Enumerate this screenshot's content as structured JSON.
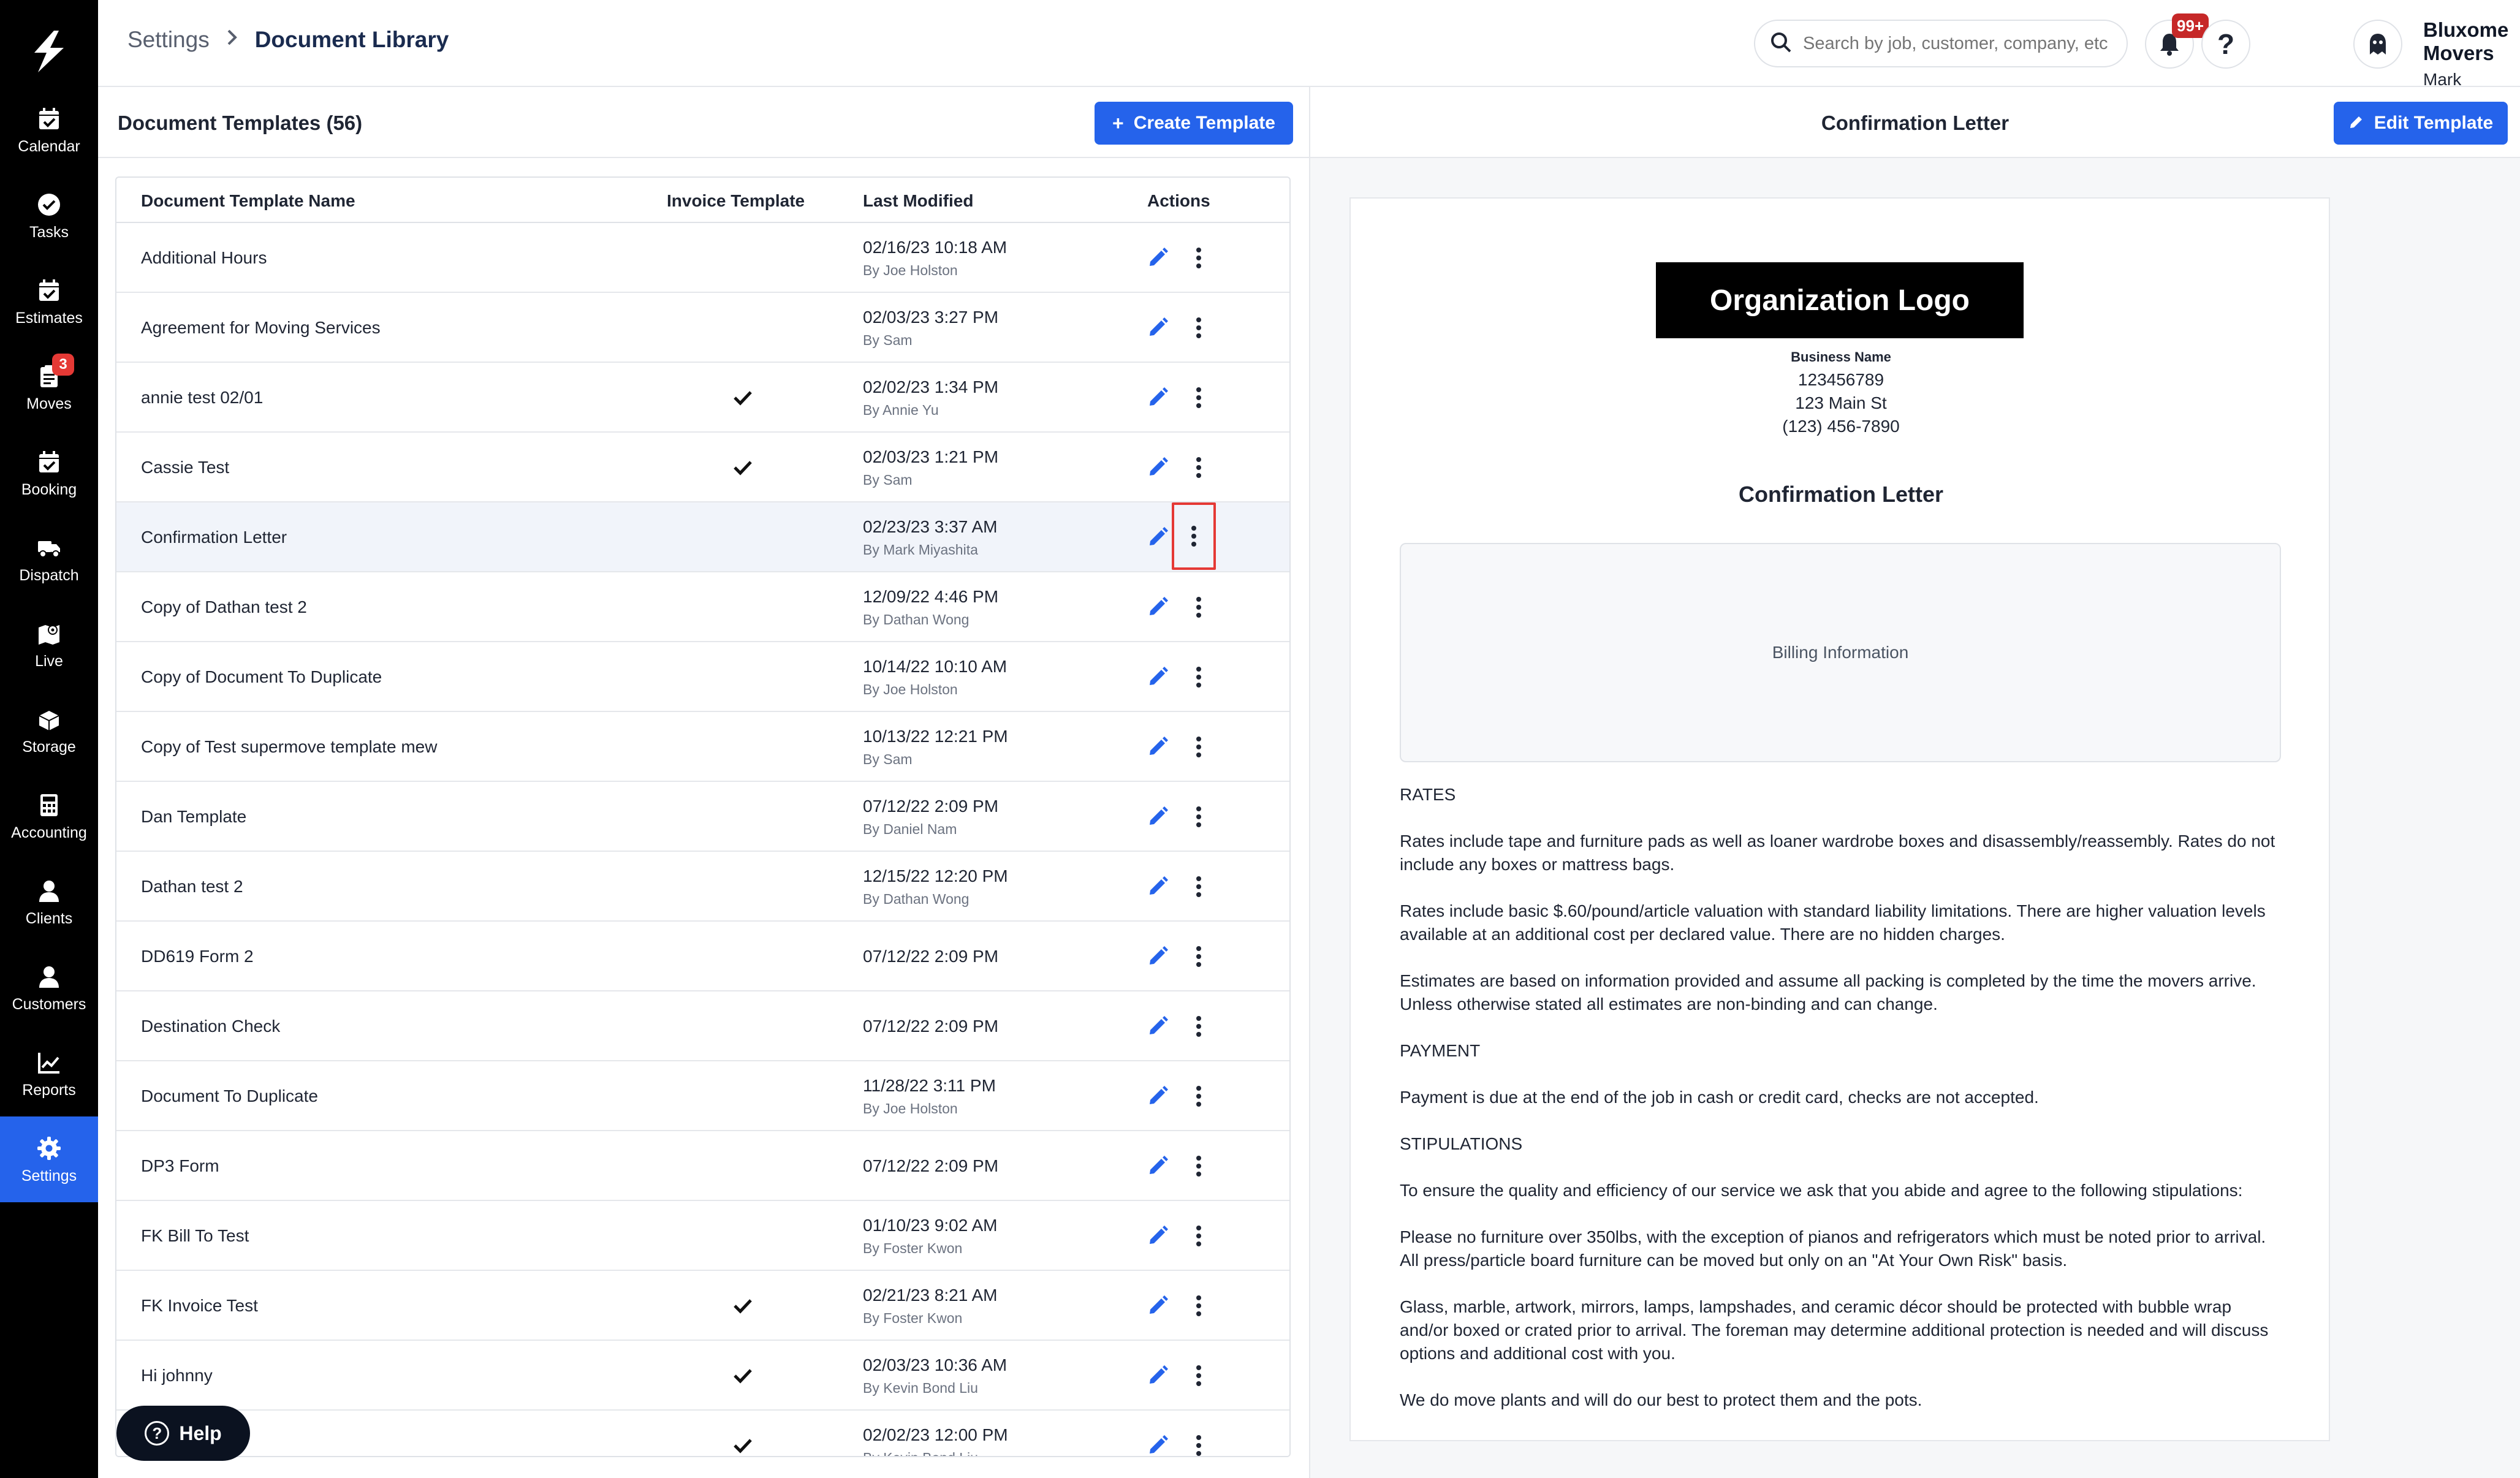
{
  "sidebar": {
    "items": [
      {
        "label": "Calendar",
        "icon": "calendar-check-icon",
        "badge": ""
      },
      {
        "label": "Tasks",
        "icon": "check-circle-icon",
        "badge": ""
      },
      {
        "label": "Estimates",
        "icon": "calendar-check-icon",
        "badge": ""
      },
      {
        "label": "Moves",
        "icon": "clipboard-icon",
        "badge": "3"
      },
      {
        "label": "Booking",
        "icon": "calendar-check-icon",
        "badge": ""
      },
      {
        "label": "Dispatch",
        "icon": "truck-icon",
        "badge": ""
      },
      {
        "label": "Live",
        "icon": "map-icon",
        "badge": ""
      },
      {
        "label": "Storage",
        "icon": "boxes-icon",
        "badge": ""
      },
      {
        "label": "Accounting",
        "icon": "calculator-icon",
        "badge": ""
      },
      {
        "label": "Clients",
        "icon": "user-icon",
        "badge": ""
      },
      {
        "label": "Customers",
        "icon": "user-icon",
        "badge": ""
      },
      {
        "label": "Reports",
        "icon": "chart-icon",
        "badge": ""
      },
      {
        "label": "Settings",
        "icon": "gear-icon",
        "badge": "",
        "active": true
      }
    ],
    "active_color": "#2563eb"
  },
  "header": {
    "breadcrumb": {
      "parent": "Settings",
      "current": "Document Library"
    },
    "search_placeholder": "Search by job, customer, company, etc...",
    "notification_badge": "99+",
    "company": "Bluxome Movers",
    "user": "Mark Miyashita"
  },
  "templates_panel": {
    "title": "Document Templates (56)",
    "create_button": "Create Template",
    "columns": {
      "name": "Document Template Name",
      "invoice": "Invoice Template",
      "modified": "Last Modified",
      "actions": "Actions"
    },
    "rows": [
      {
        "name": "Additional Hours",
        "invoice": false,
        "date": "02/16/23 10:18 AM",
        "by": "By Joe Holston"
      },
      {
        "name": "Agreement for Moving Services",
        "invoice": false,
        "date": "02/03/23 3:27 PM",
        "by": "By Sam"
      },
      {
        "name": "annie test 02/01",
        "invoice": true,
        "date": "02/02/23 1:34 PM",
        "by": "By Annie Yu"
      },
      {
        "name": "Cassie Test",
        "invoice": true,
        "date": "02/03/23 1:21 PM",
        "by": "By Sam"
      },
      {
        "name": "Confirmation Letter",
        "invoice": false,
        "date": "02/23/23 3:37 AM",
        "by": "By Mark Miyashita",
        "selected": true
      },
      {
        "name": "Copy of Dathan test 2",
        "invoice": false,
        "date": "12/09/22 4:46 PM",
        "by": "By Dathan Wong"
      },
      {
        "name": "Copy of Document To Duplicate",
        "invoice": false,
        "date": "10/14/22 10:10 AM",
        "by": "By Joe Holston"
      },
      {
        "name": "Copy of Test supermove template mew",
        "invoice": false,
        "date": "10/13/22 12:21 PM",
        "by": "By Sam"
      },
      {
        "name": "Dan Template",
        "invoice": false,
        "date": "07/12/22 2:09 PM",
        "by": "By Daniel Nam"
      },
      {
        "name": "Dathan test 2",
        "invoice": false,
        "date": "12/15/22 12:20 PM",
        "by": "By Dathan Wong"
      },
      {
        "name": "DD619 Form 2",
        "invoice": false,
        "date": "07/12/22 2:09 PM",
        "by": ""
      },
      {
        "name": "Destination Check",
        "invoice": false,
        "date": "07/12/22 2:09 PM",
        "by": ""
      },
      {
        "name": "Document To Duplicate",
        "invoice": false,
        "date": "11/28/22 3:11 PM",
        "by": "By Joe Holston"
      },
      {
        "name": "DP3 Form",
        "invoice": false,
        "date": "07/12/22 2:09 PM",
        "by": ""
      },
      {
        "name": "FK Bill To Test",
        "invoice": false,
        "date": "01/10/23 9:02 AM",
        "by": "By Foster Kwon"
      },
      {
        "name": "FK Invoice Test",
        "invoice": true,
        "date": "02/21/23 8:21 AM",
        "by": "By Foster Kwon"
      },
      {
        "name": "Hi johnny",
        "invoice": true,
        "date": "02/03/23 10:36 AM",
        "by": "By Kevin Bond Liu"
      },
      {
        "name": "",
        "invoice": true,
        "date": "02/02/23 12:00 PM",
        "by": "By Kevin Bond Liu"
      }
    ],
    "help_button": "Help"
  },
  "preview_panel": {
    "title": "Confirmation Letter",
    "edit_button": "Edit Template",
    "document": {
      "logo_text": "Organization Logo",
      "business_name": "Business Name",
      "business_number": "123456789",
      "address": "123 Main St",
      "phone": "(123) 456-7890",
      "title": "Confirmation Letter",
      "billing_placeholder": "Billing Information",
      "paragraphs": [
        "RATES",
        "Rates include tape and furniture pads as well as loaner wardrobe boxes and disassembly/reassembly. Rates do not include any boxes or mattress bags.",
        "Rates include basic $.60/pound/article valuation with standard liability limitations. There are higher valuation levels available at an additional cost per declared value. There are no hidden charges.",
        "Estimates are based on information provided and assume all packing is completed by the time the movers arrive. Unless otherwise stated all estimates are non-binding and can change.",
        "PAYMENT",
        "Payment is due at the end of the job in cash or credit card, checks are not accepted.",
        "STIPULATIONS",
        "To ensure the quality and efficiency of our service we ask that you abide and agree to the following stipulations:",
        "Please no furniture over 350lbs, with the exception of pianos and refrigerators which must be noted prior to arrival. All press/particle board furniture can be moved but only on an \"At Your Own Risk\" basis.",
        "Glass, marble, artwork, mirrors, lamps, lampshades, and ceramic décor should be protected with bubble wrap and/or boxed or crated prior to arrival. The foreman may determine additional protection is needed and will discuss options and additional cost with you.",
        "We do move plants and will do our best to protect them and the pots."
      ]
    }
  },
  "colors": {
    "primary": "#2563eb",
    "highlight_border": "#e53935",
    "badge": "#c62828",
    "selected_row": "#f1f4fa"
  }
}
